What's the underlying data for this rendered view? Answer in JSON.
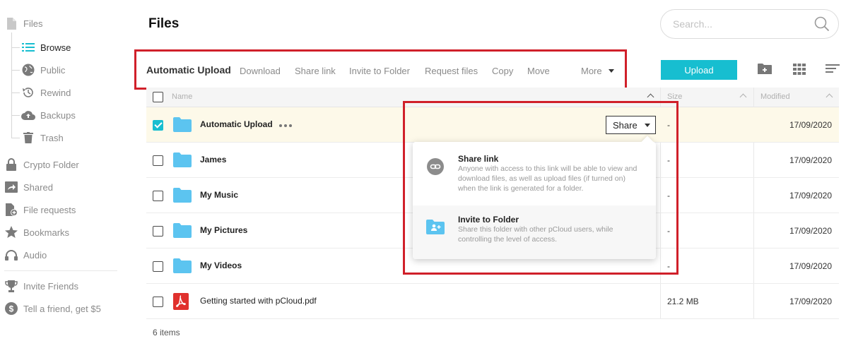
{
  "sidebar": {
    "items": [
      {
        "label": "Files",
        "icon": "file-icon"
      },
      {
        "label": "Browse",
        "icon": "list-icon"
      },
      {
        "label": "Public",
        "icon": "globe-icon"
      },
      {
        "label": "Rewind",
        "icon": "history-icon"
      },
      {
        "label": "Backups",
        "icon": "cloud-upload-icon"
      },
      {
        "label": "Trash",
        "icon": "trash-icon"
      },
      {
        "label": "Crypto Folder",
        "icon": "lock-icon"
      },
      {
        "label": "Shared",
        "icon": "share-icon"
      },
      {
        "label": "File requests",
        "icon": "file-request-icon"
      },
      {
        "label": "Bookmarks",
        "icon": "star-icon"
      },
      {
        "label": "Audio",
        "icon": "headphones-icon"
      },
      {
        "label": "Invite Friends",
        "icon": "trophy-icon"
      },
      {
        "label": "Tell a friend, get $5",
        "icon": "dollar-icon"
      }
    ]
  },
  "header": {
    "title": "Files",
    "search_placeholder": "Search..."
  },
  "toolbar": {
    "selected_title": "Automatic Upload",
    "actions": [
      "Download",
      "Share link",
      "Invite to Folder",
      "Request files",
      "Copy",
      "Move"
    ],
    "more_label": "More",
    "upload_label": "Upload"
  },
  "table": {
    "columns": {
      "name": "Name",
      "size": "Size",
      "modified": "Modified"
    },
    "rows": [
      {
        "name": "Automatic Upload",
        "type": "folder",
        "size": "-",
        "modified": "17/09/2020",
        "selected": true
      },
      {
        "name": "James",
        "type": "folder",
        "size": "-",
        "modified": "17/09/2020",
        "selected": false
      },
      {
        "name": "My Music",
        "type": "folder",
        "size": "-",
        "modified": "17/09/2020",
        "selected": false
      },
      {
        "name": "My Pictures",
        "type": "folder",
        "size": "-",
        "modified": "17/09/2020",
        "selected": false
      },
      {
        "name": "My Videos",
        "type": "folder",
        "size": "-",
        "modified": "17/09/2020",
        "selected": false
      },
      {
        "name": "Getting started with pCloud.pdf",
        "type": "pdf",
        "size": "21.2 MB",
        "modified": "17/09/2020",
        "selected": false
      }
    ],
    "share_button_label": "Share",
    "items_count": "6 items"
  },
  "share_menu": {
    "items": [
      {
        "title": "Share link",
        "description": "Anyone with access to this link will be able to view and download files, as well as upload files (if turned on) when the link is generated for a folder.",
        "icon": "link-icon"
      },
      {
        "title": "Invite to Folder",
        "description": "Share this folder with other pCloud users, while controlling the level of access.",
        "icon": "folder-user-icon"
      }
    ]
  },
  "colors": {
    "accent": "#17bed0",
    "highlight_border": "#d0202a",
    "folder": "#5cc4f0",
    "selected_row": "#fdf9e9",
    "pdf": "#e0312d"
  }
}
